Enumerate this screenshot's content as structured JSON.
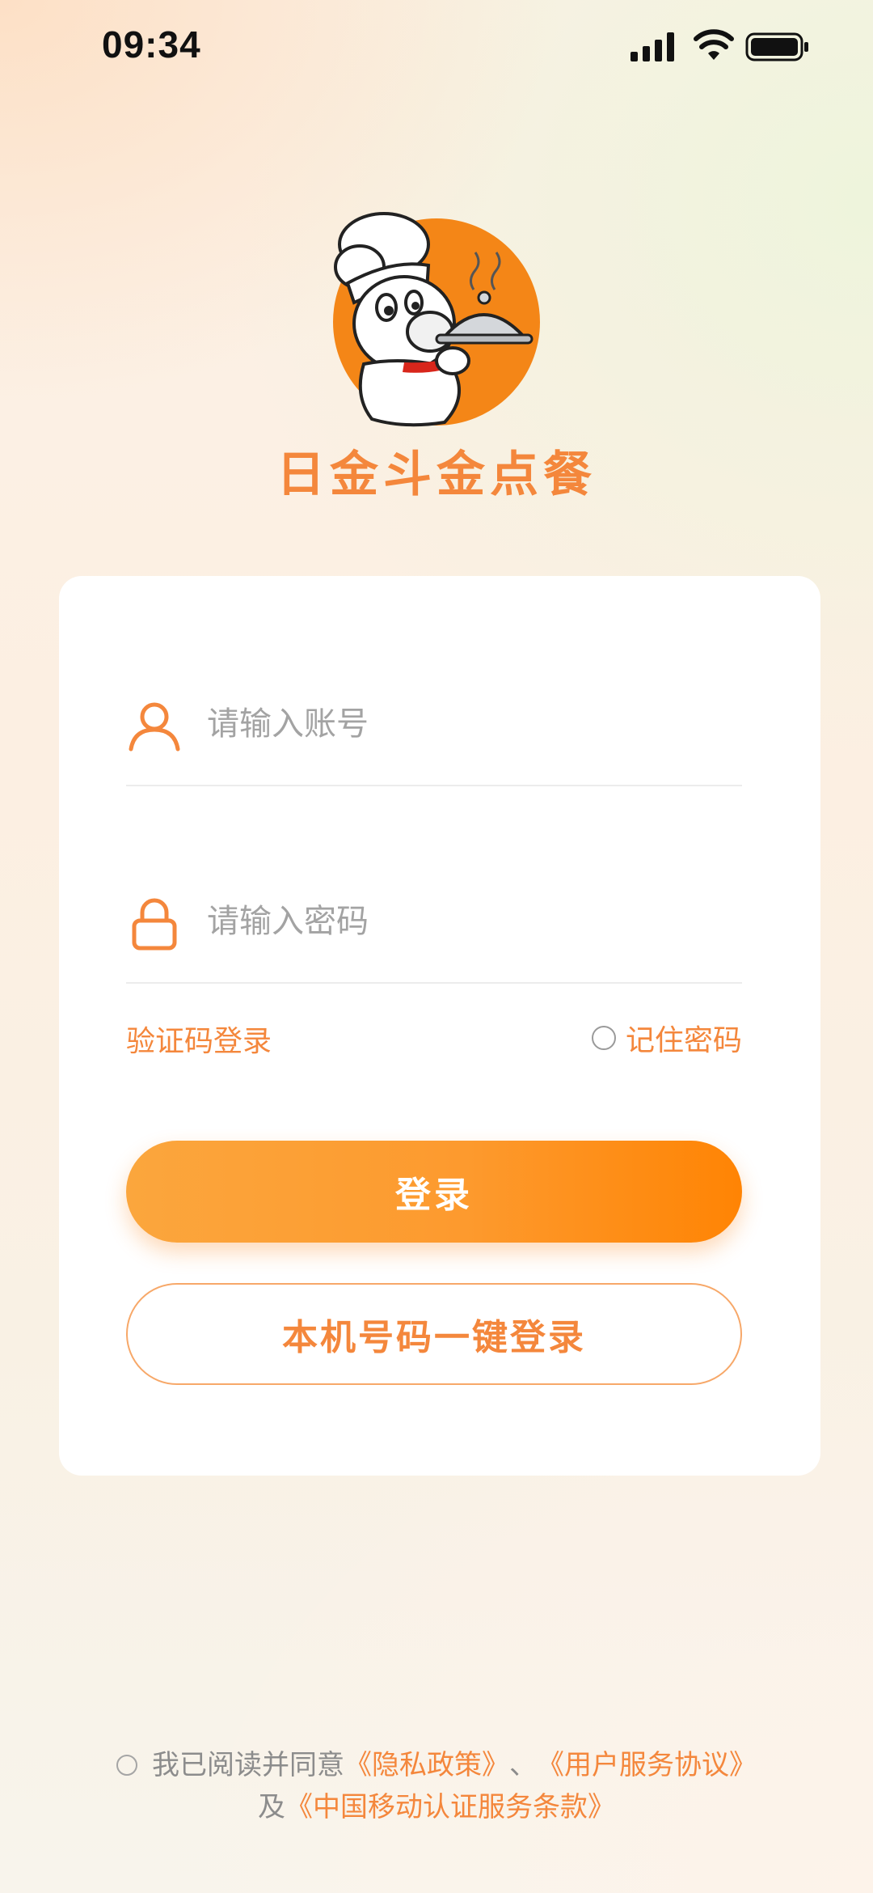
{
  "status_bar": {
    "time": "09:34"
  },
  "app": {
    "title": "日金斗金点餐"
  },
  "form": {
    "account_placeholder": "请输入账号",
    "password_placeholder": "请输入密码",
    "sms_login_label": "验证码登录",
    "remember_label": "记住密码",
    "remember_checked": false,
    "login_label": "登录",
    "one_click_label": "本机号码一键登录"
  },
  "agreement": {
    "checked": false,
    "prefix": "我已阅读并同意",
    "privacy_link": "《隐私政策》",
    "separator": "、",
    "service_link": "《用户服务协议》",
    "and_text": "及",
    "cmcc_link": "《中国移动认证服务条款》"
  },
  "colors": {
    "accent": "#f4873c",
    "button_gradient_start": "#fba63d",
    "button_gradient_end": "#ff8404"
  },
  "icons": {
    "account": "user-icon",
    "password": "lock-icon"
  }
}
